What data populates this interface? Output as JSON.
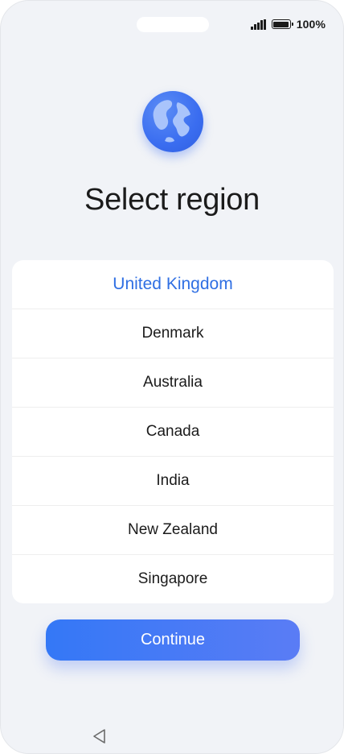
{
  "status_bar": {
    "signal_icon": "cellular-signal-icon",
    "battery_icon": "battery-icon",
    "battery_level": 1.0,
    "battery_text": "100%"
  },
  "header": {
    "icon": "globe-icon",
    "title": "Select region"
  },
  "regions": {
    "selected": "United Kingdom",
    "items": [
      {
        "label": "United Kingdom",
        "selected": true
      },
      {
        "label": "Denmark",
        "selected": false
      },
      {
        "label": "Australia",
        "selected": false
      },
      {
        "label": "Canada",
        "selected": false
      },
      {
        "label": "India",
        "selected": false
      },
      {
        "label": "New Zealand",
        "selected": false
      },
      {
        "label": "Singapore",
        "selected": false
      }
    ]
  },
  "actions": {
    "continue_label": "Continue"
  },
  "nav_bar": {
    "back_icon": "back-triangle-icon"
  },
  "colors": {
    "accent": "#2f6fe3",
    "button_gradient_start": "#3478f6",
    "button_gradient_end": "#5a7cf5",
    "background": "#f1f3f7"
  }
}
